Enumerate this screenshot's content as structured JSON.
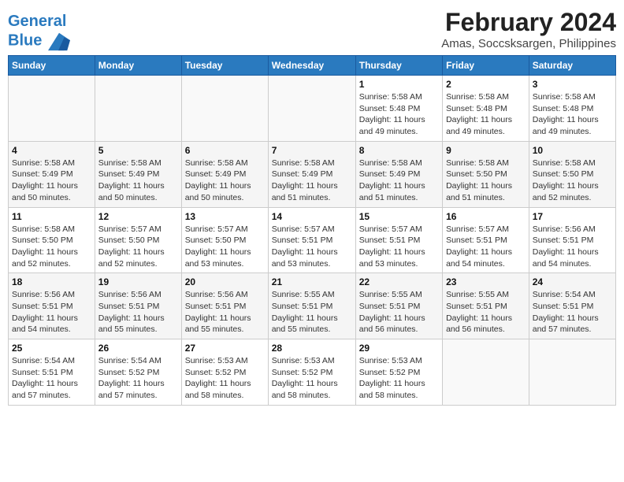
{
  "header": {
    "logo_line1": "General",
    "logo_line2": "Blue",
    "title": "February 2024",
    "subtitle": "Amas, Soccsksargen, Philippines"
  },
  "columns": [
    "Sunday",
    "Monday",
    "Tuesday",
    "Wednesday",
    "Thursday",
    "Friday",
    "Saturday"
  ],
  "weeks": [
    [
      {
        "day": "",
        "info": ""
      },
      {
        "day": "",
        "info": ""
      },
      {
        "day": "",
        "info": ""
      },
      {
        "day": "",
        "info": ""
      },
      {
        "day": "1",
        "info": "Sunrise: 5:58 AM\nSunset: 5:48 PM\nDaylight: 11 hours and 49 minutes."
      },
      {
        "day": "2",
        "info": "Sunrise: 5:58 AM\nSunset: 5:48 PM\nDaylight: 11 hours and 49 minutes."
      },
      {
        "day": "3",
        "info": "Sunrise: 5:58 AM\nSunset: 5:48 PM\nDaylight: 11 hours and 49 minutes."
      }
    ],
    [
      {
        "day": "4",
        "info": "Sunrise: 5:58 AM\nSunset: 5:49 PM\nDaylight: 11 hours and 50 minutes."
      },
      {
        "day": "5",
        "info": "Sunrise: 5:58 AM\nSunset: 5:49 PM\nDaylight: 11 hours and 50 minutes."
      },
      {
        "day": "6",
        "info": "Sunrise: 5:58 AM\nSunset: 5:49 PM\nDaylight: 11 hours and 50 minutes."
      },
      {
        "day": "7",
        "info": "Sunrise: 5:58 AM\nSunset: 5:49 PM\nDaylight: 11 hours and 51 minutes."
      },
      {
        "day": "8",
        "info": "Sunrise: 5:58 AM\nSunset: 5:49 PM\nDaylight: 11 hours and 51 minutes."
      },
      {
        "day": "9",
        "info": "Sunrise: 5:58 AM\nSunset: 5:50 PM\nDaylight: 11 hours and 51 minutes."
      },
      {
        "day": "10",
        "info": "Sunrise: 5:58 AM\nSunset: 5:50 PM\nDaylight: 11 hours and 52 minutes."
      }
    ],
    [
      {
        "day": "11",
        "info": "Sunrise: 5:58 AM\nSunset: 5:50 PM\nDaylight: 11 hours and 52 minutes."
      },
      {
        "day": "12",
        "info": "Sunrise: 5:57 AM\nSunset: 5:50 PM\nDaylight: 11 hours and 52 minutes."
      },
      {
        "day": "13",
        "info": "Sunrise: 5:57 AM\nSunset: 5:50 PM\nDaylight: 11 hours and 53 minutes."
      },
      {
        "day": "14",
        "info": "Sunrise: 5:57 AM\nSunset: 5:51 PM\nDaylight: 11 hours and 53 minutes."
      },
      {
        "day": "15",
        "info": "Sunrise: 5:57 AM\nSunset: 5:51 PM\nDaylight: 11 hours and 53 minutes."
      },
      {
        "day": "16",
        "info": "Sunrise: 5:57 AM\nSunset: 5:51 PM\nDaylight: 11 hours and 54 minutes."
      },
      {
        "day": "17",
        "info": "Sunrise: 5:56 AM\nSunset: 5:51 PM\nDaylight: 11 hours and 54 minutes."
      }
    ],
    [
      {
        "day": "18",
        "info": "Sunrise: 5:56 AM\nSunset: 5:51 PM\nDaylight: 11 hours and 54 minutes."
      },
      {
        "day": "19",
        "info": "Sunrise: 5:56 AM\nSunset: 5:51 PM\nDaylight: 11 hours and 55 minutes."
      },
      {
        "day": "20",
        "info": "Sunrise: 5:56 AM\nSunset: 5:51 PM\nDaylight: 11 hours and 55 minutes."
      },
      {
        "day": "21",
        "info": "Sunrise: 5:55 AM\nSunset: 5:51 PM\nDaylight: 11 hours and 55 minutes."
      },
      {
        "day": "22",
        "info": "Sunrise: 5:55 AM\nSunset: 5:51 PM\nDaylight: 11 hours and 56 minutes."
      },
      {
        "day": "23",
        "info": "Sunrise: 5:55 AM\nSunset: 5:51 PM\nDaylight: 11 hours and 56 minutes."
      },
      {
        "day": "24",
        "info": "Sunrise: 5:54 AM\nSunset: 5:51 PM\nDaylight: 11 hours and 57 minutes."
      }
    ],
    [
      {
        "day": "25",
        "info": "Sunrise: 5:54 AM\nSunset: 5:51 PM\nDaylight: 11 hours and 57 minutes."
      },
      {
        "day": "26",
        "info": "Sunrise: 5:54 AM\nSunset: 5:52 PM\nDaylight: 11 hours and 57 minutes."
      },
      {
        "day": "27",
        "info": "Sunrise: 5:53 AM\nSunset: 5:52 PM\nDaylight: 11 hours and 58 minutes."
      },
      {
        "day": "28",
        "info": "Sunrise: 5:53 AM\nSunset: 5:52 PM\nDaylight: 11 hours and 58 minutes."
      },
      {
        "day": "29",
        "info": "Sunrise: 5:53 AM\nSunset: 5:52 PM\nDaylight: 11 hours and 58 minutes."
      },
      {
        "day": "",
        "info": ""
      },
      {
        "day": "",
        "info": ""
      }
    ]
  ]
}
